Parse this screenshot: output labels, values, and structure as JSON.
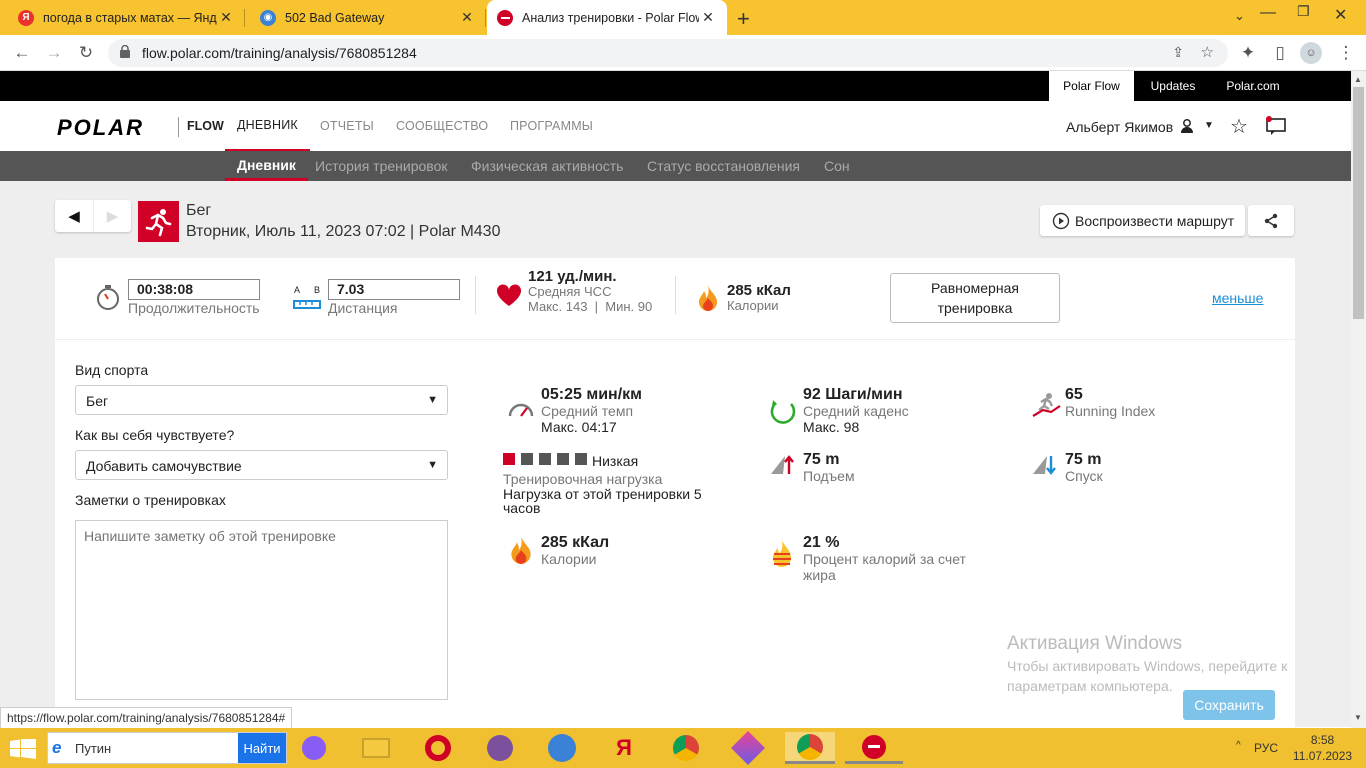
{
  "browser": {
    "tabs": [
      {
        "title": "погода в старых матах — Яндекс",
        "favicon": "yandex-icon"
      },
      {
        "title": "502 Bad Gateway",
        "favicon": "globe-icon"
      },
      {
        "title": "Анализ тренировки - Polar Flow",
        "favicon": "polar-icon"
      }
    ],
    "url": "flow.polar.com/training/analysis/7680851284",
    "status_url": "https://flow.polar.com/training/analysis/7680851284#"
  },
  "topbar": {
    "links": [
      "Polar Flow",
      "Updates",
      "Polar.com"
    ]
  },
  "header": {
    "logo": "POLAR",
    "flow": "FLOW",
    "nav": [
      "ДНЕВНИК",
      "ОТЧЕТЫ",
      "СООБЩЕСТВО",
      "ПРОГРАММЫ"
    ],
    "user": "Альберт Якимов"
  },
  "subnav": [
    "Дневник",
    "История тренировок",
    "Физическая активность",
    "Статус восстановления",
    "Сон"
  ],
  "session": {
    "sport": "Бег",
    "datetime": "Вторник, Июль 11, 2023 07:02 | Polar M430",
    "replay_label": "Воспроизвести маршрут"
  },
  "summary": {
    "duration": "00:38:08",
    "duration_label": "Продолжительность",
    "distance": "7.03",
    "distance_label": "Дистанция",
    "ab_a": "A",
    "ab_b": "B",
    "hr": "121 уд./мин.",
    "hr_label": "Средняя ЧСС",
    "hr_extra": "Макс. 143  |  Мин. 90",
    "calories": "285 кКал",
    "calories_label": "Калории",
    "type_button": "Равномерная тренировка",
    "less_link": "меньше"
  },
  "form": {
    "sport_label": "Вид спорта",
    "sport_value": "Бег",
    "feel_label": "Как вы себя чувствуете?",
    "feel_value": "Добавить самочувствие",
    "notes_label": "Заметки о тренировках",
    "notes_placeholder": "Напишите заметку об этой тренировке"
  },
  "stats": {
    "pace": {
      "value": "05:25 мин/км",
      "label": "Средний темп",
      "extra": "Макс. 04:17"
    },
    "cadence": {
      "value": "92 Шаги/мин",
      "label": "Средний каденс",
      "extra": "Макс. 98"
    },
    "running_index": {
      "value": "65",
      "label": "Running Index"
    },
    "load": {
      "level": "Низкая",
      "level_fraction": 0.2,
      "label": "Тренировочная нагрузка",
      "extra": "Нагрузка от этой тренировки 5 часов"
    },
    "ascent": {
      "value": "75 m",
      "label": "Подъем"
    },
    "descent": {
      "value": "75 m",
      "label": "Спуск"
    },
    "calories": {
      "value": "285 кКал",
      "label": "Калории"
    },
    "fat": {
      "value": "21 %",
      "label": "Процент калорий за счет жира"
    }
  },
  "watermark": {
    "title": "Активация Windows",
    "line1": "Чтобы активировать Windows, перейдите к",
    "line2": "параметрам компьютера."
  },
  "save_button": "Сохранить",
  "taskbar": {
    "search_value": "Путин",
    "search_button": "Найти",
    "lang": "РУС",
    "time": "8:58",
    "date": "11.07.2023"
  },
  "colors": {
    "accent": "#d10027",
    "link": "#1a8fd8",
    "save": "#7ec3ea"
  }
}
